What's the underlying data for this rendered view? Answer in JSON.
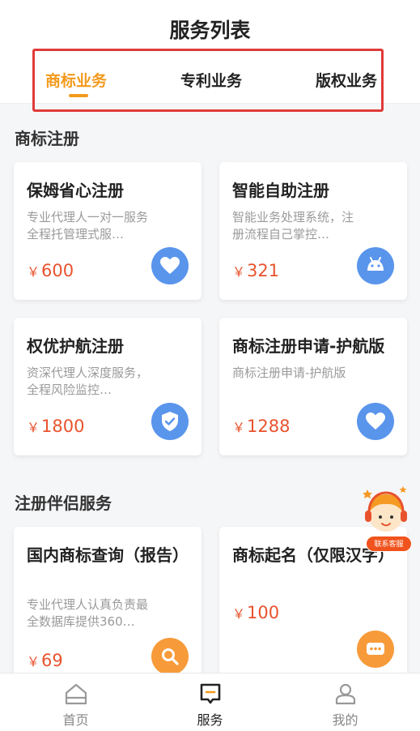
{
  "header": {
    "title": "服务列表",
    "tabs": [
      {
        "label": "商标业务",
        "active": true
      },
      {
        "label": "专利业务",
        "active": false
      },
      {
        "label": "版权业务",
        "active": false
      }
    ]
  },
  "sections": [
    {
      "title": "商标注册",
      "cards": [
        {
          "title": "保姆省心注册",
          "desc": "专业代理人一对一服务全程托管理式服…",
          "currency": "￥",
          "price": "600",
          "icon": "heart-icon"
        },
        {
          "title": "智能自助注册",
          "desc": "智能业务处理系统，注册流程自己掌控…",
          "currency": "￥",
          "price": "321",
          "icon": "android-icon"
        },
        {
          "title": "权优护航注册",
          "desc": "资深代理人深度服务，全程风险监控…",
          "currency": "￥",
          "price": "1800",
          "icon": "shield-check-icon"
        },
        {
          "title": "商标注册申请-护航版",
          "desc": "商标注册申请-护航版",
          "currency": "￥",
          "price": "1288",
          "icon": "heart-icon"
        }
      ]
    },
    {
      "title": "注册伴侣服务",
      "cards": [
        {
          "title": "国内商标查询（报告）",
          "desc": "专业代理人认真负责最全数据库提供360…",
          "currency": "￥",
          "price": "69",
          "icon": "search-icon"
        },
        {
          "title": "商标起名（仅限汉字）",
          "desc": "",
          "currency": "￥",
          "price": "100",
          "icon": "chat-icon"
        }
      ]
    }
  ],
  "customer_service": {
    "label": "联系客服"
  },
  "bottom_nav": [
    {
      "label": "首页",
      "icon": "home-icon",
      "active": false
    },
    {
      "label": "服务",
      "icon": "service-icon",
      "active": true
    },
    {
      "label": "我的",
      "icon": "profile-icon",
      "active": false
    }
  ],
  "colors": {
    "accent": "#f39a1d",
    "price": "#e8532d",
    "icon_blue": "#5a95ec",
    "icon_orange": "#f79b3a",
    "highlight_box": "#e03a3a"
  }
}
